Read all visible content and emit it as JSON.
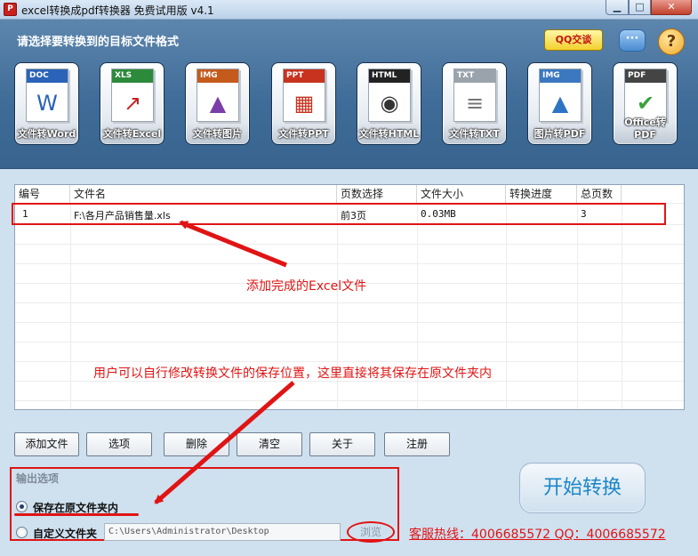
{
  "window": {
    "title": "excel转换成pdf转换器 免费试用版 v4.1",
    "app_icon_text": "P",
    "min_glyph": "▁",
    "max_glyph": "□",
    "close_glyph": "✕"
  },
  "header": {
    "heading": "请选择要转换到的目标文件格式",
    "qq_label": "QQ交谈",
    "chat_glyph": "···",
    "help_glyph": "?"
  },
  "tiles": [
    {
      "badge": "DOC",
      "label": "文件转Word",
      "icon": "word-doc-icon",
      "band_color": "#2a63b8"
    },
    {
      "badge": "XLS",
      "label": "文件转Excel",
      "icon": "excel-chart-icon",
      "band_color": "#2c8a3a"
    },
    {
      "badge": "IMG",
      "label": "文件转图片",
      "icon": "image-photo-icon",
      "band_color": "#c55a1d"
    },
    {
      "badge": "PPT",
      "label": "文件转PPT",
      "icon": "ppt-slide-icon",
      "band_color": "#c7331f"
    },
    {
      "badge": "HTML",
      "label": "文件转HTML",
      "icon": "html-globe-icon",
      "band_color": "#222222"
    },
    {
      "badge": "TXT",
      "label": "文件转TXT",
      "icon": "txt-text-icon",
      "band_color": "#9aa3ab"
    },
    {
      "badge": "IMG",
      "label": "图片转PDF",
      "icon": "image-to-pdf-icon",
      "band_color": "#3b78c0"
    },
    {
      "badge": "PDF",
      "label": "Office转PDF",
      "icon": "pdf-check-icon",
      "band_color": "#444444"
    }
  ],
  "table": {
    "columns": [
      "编号",
      "文件名",
      "页数选择",
      "文件大小",
      "转换进度",
      "总页数"
    ],
    "rows": [
      [
        "1",
        "F:\\各月产品销售量.xls",
        "前3页",
        "0.03MB",
        "",
        "3"
      ]
    ]
  },
  "annotations": {
    "added": "添加完成的Excel文件",
    "save_note": "用户可以自行修改转换文件的保存位置，这里直接将其保存在原文件夹内"
  },
  "buttons": {
    "add_file": "添加文件",
    "options": "选项",
    "delete": "删除",
    "clear": "清空",
    "about": "关于",
    "register": "注册"
  },
  "output": {
    "section_label": "输出选项",
    "save_original": "保存在原文件夹内",
    "custom_folder": "自定义文件夹",
    "path": "C:\\Users\\Administrator\\Desktop",
    "browse": "浏览",
    "selected": "save_original"
  },
  "start_label": "开始转换",
  "hotline": "客服热线：4006685572 QQ：4006685572",
  "colors": {
    "panel": "#3f6c98",
    "background": "#cfe0ef",
    "annotation_red": "#e01414",
    "start_text": "#1c86c8"
  }
}
